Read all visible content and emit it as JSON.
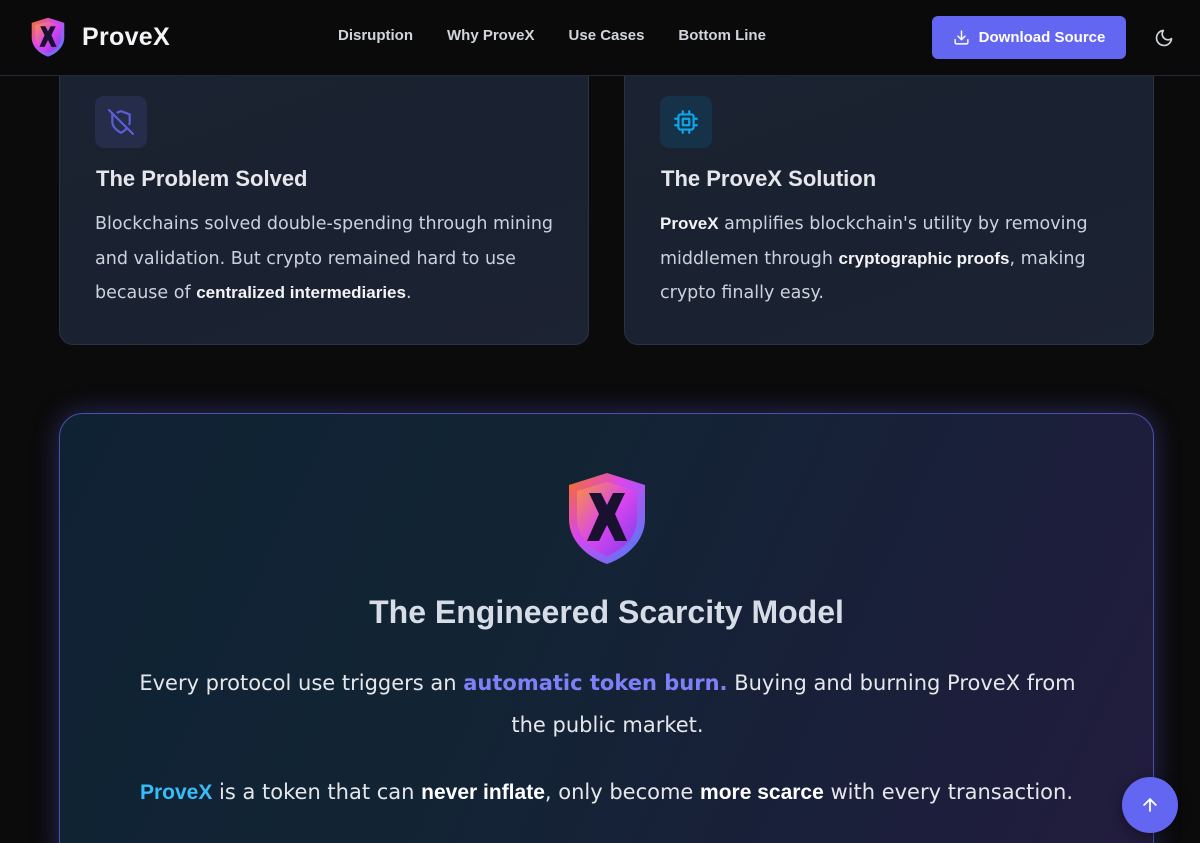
{
  "brand": {
    "name": "ProveX",
    "logo_icon": "provex-shield-logo"
  },
  "nav": {
    "links": [
      "Disruption",
      "Why ProveX",
      "Use Cases",
      "Bottom Line"
    ],
    "download_label": "Download Source",
    "download_icon": "download-icon",
    "theme_icon": "moon-icon"
  },
  "cards": [
    {
      "icon": "shield-off-icon",
      "title": "The Problem Solved",
      "text_a": "Blockchains solved double-spending through mining and validation. But crypto remained hard to use because of ",
      "bold_a": "centralized intermediaries",
      "text_b": "."
    },
    {
      "icon": "cpu-chip-icon",
      "title": "The ProveX Solution",
      "bold_a": "ProveX",
      "text_a": " amplifies blockchain's utility by removing middlemen through ",
      "bold_b": "cryptographic proofs",
      "text_b": ", making crypto finally easy."
    }
  ],
  "scarcity": {
    "title": "The Engineered Scarcity Model",
    "line1_a": "Every protocol use triggers an ",
    "line1_highlight": "automatic token burn.",
    "line1_b": " Buying and burning ProveX from the public market.",
    "line2_brand": "ProveX",
    "line2_a": " is a token that can ",
    "line2_bold_a": "never inflate",
    "line2_b": ", only become ",
    "line2_bold_b": "more scarce",
    "line2_c": " with every transaction."
  },
  "scroll_top_icon": "arrow-up-icon",
  "colors": {
    "accent": "#6366f1",
    "highlight_purple": "#7e80f7",
    "highlight_blue": "#38bdf8",
    "background": "#0b0b0c"
  }
}
